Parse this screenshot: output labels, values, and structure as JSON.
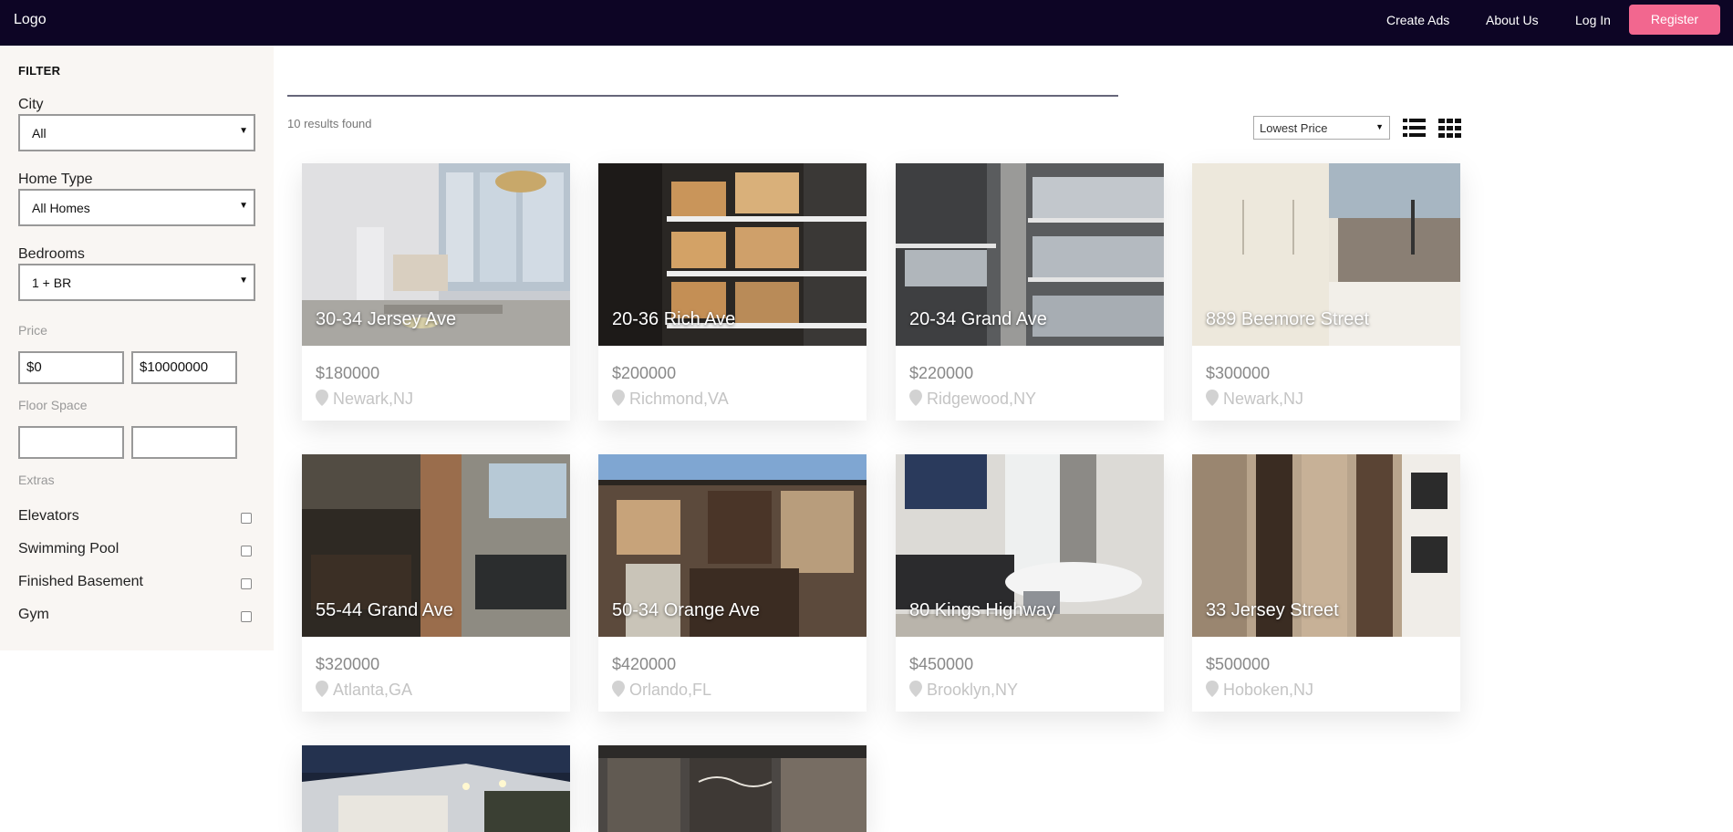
{
  "nav": {
    "logo": "Logo",
    "links": [
      "Create Ads",
      "About Us",
      "Log In"
    ],
    "register": "Register"
  },
  "filter": {
    "title": "FILTER",
    "city": {
      "label": "City",
      "value": "All"
    },
    "home_type": {
      "label": "Home Type",
      "value": "All Homes"
    },
    "bedrooms": {
      "label": "Bedrooms",
      "value": "1 + BR"
    },
    "price": {
      "label": "Price",
      "min": "$0",
      "max": "$10000000"
    },
    "floor_space": {
      "label": "Floor Space",
      "min": "",
      "max": ""
    },
    "extras": {
      "label": "Extras",
      "items": [
        "Elevators",
        "Swimming Pool",
        "Finished Basement",
        "Gym"
      ]
    }
  },
  "results": {
    "count_text": "10 results found",
    "sort": "Lowest Price",
    "listings": [
      {
        "title": "30-34 Jersey Ave",
        "price": "$180000",
        "location": "Newark,NJ"
      },
      {
        "title": "20-36 Rich Ave",
        "price": "$200000",
        "location": "Richmond,VA"
      },
      {
        "title": "20-34 Grand Ave",
        "price": "$220000",
        "location": "Ridgewood,NY"
      },
      {
        "title": "889 Beemore Street",
        "price": "$300000",
        "location": "Newark,NJ"
      },
      {
        "title": "55-44 Grand Ave",
        "price": "$320000",
        "location": "Atlanta,GA"
      },
      {
        "title": "50-34 Orange Ave",
        "price": "$420000",
        "location": "Orlando,FL"
      },
      {
        "title": "80 Kings Highway",
        "price": "$450000",
        "location": "Brooklyn,NY"
      },
      {
        "title": "33 Jersey Street",
        "price": "$500000",
        "location": "Hoboken,NJ"
      },
      {
        "title": "",
        "price": "",
        "location": ""
      },
      {
        "title": "",
        "price": "",
        "location": ""
      }
    ]
  },
  "colors": {
    "nav_bg": "#0d0525",
    "register_bg": "#f2678f",
    "sidebar_bg": "#f9f6f3"
  },
  "icons": [
    "location-pin-icon",
    "list-view-icon",
    "grid-view-icon",
    "caret-down-icon"
  ]
}
